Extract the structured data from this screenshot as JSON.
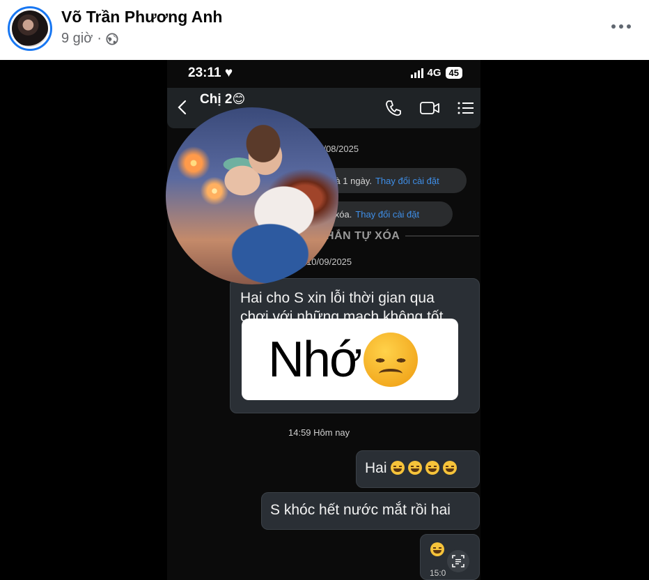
{
  "post": {
    "author": "Võ Trần Phương Anh",
    "time": "9 giờ",
    "separator": "·",
    "privacy_icon": "globe-icon",
    "more_icon": "more-horizontal-icon"
  },
  "phone": {
    "status_time": "23:11",
    "heart": "♥",
    "network": "4G",
    "battery": "45",
    "contact_name": "Chị 2",
    "contact_emoji": "😊",
    "date_1": "20/08/2025",
    "sys_1_text": "xóa là 1 ngày.",
    "sys_1_link": "Thay đổi cài đặt",
    "sys_2_text": "n tự xóa.",
    "sys_2_link": "Thay đổi cài đặt",
    "auto_delete_label": "NHẮN TỰ XÓA",
    "date_2": "16 10/09/2025",
    "message_long": "Hai cho S xin lỗi thời gian qua\nchơi với những mạch không tốt ,",
    "time_label": "14:59 Hôm nay",
    "msg_hai": "Hai",
    "msg_khoc": "S khóc hết nước mắt rồi hai",
    "msg_last_time": "15:0"
  },
  "sticker": {
    "text": "Nhớ",
    "emoji": "pensive-face"
  },
  "colors": {
    "accent": "#1877f2",
    "link": "#3f8fe8",
    "bubble": "#2a2f35"
  }
}
